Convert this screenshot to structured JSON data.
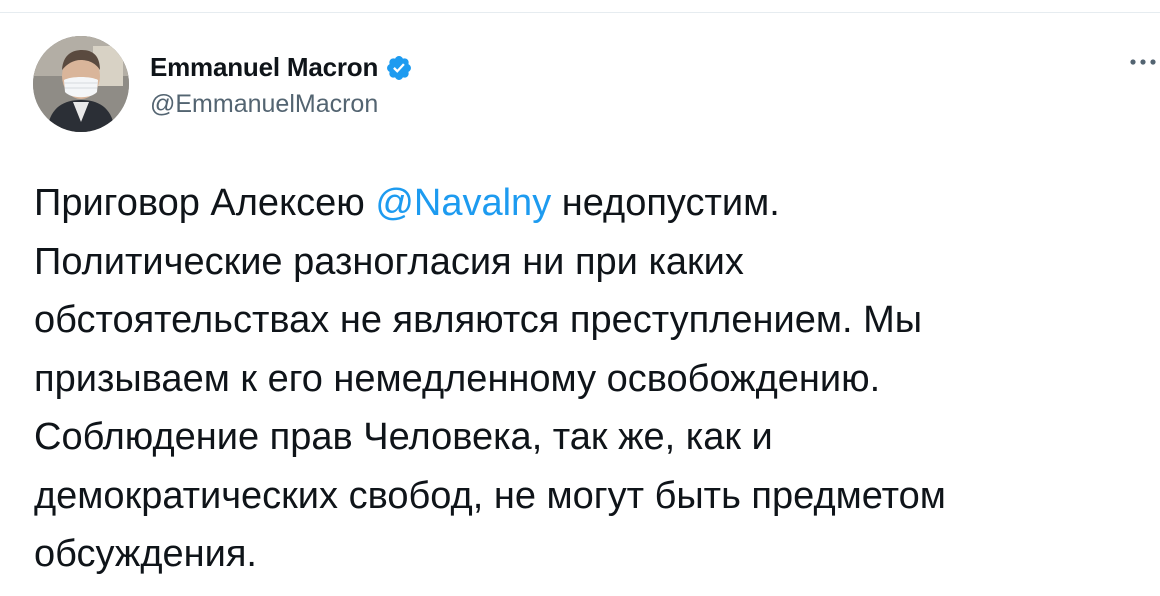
{
  "tweet": {
    "author": {
      "display_name": "Emmanuel Macron",
      "handle": "@EmmanuelMacron",
      "verified": true,
      "avatar_icon": "user-avatar-photo"
    },
    "text_before_mention": "Приговор Алексею ",
    "mention": "@Navalny",
    "text_after_mention": " недопустим.\nПолитические разногласия ни при каких\nобстоятельствах не являются преступлением. Мы\nпризываем к его немедленному освобождению.\nСоблюдение прав Человека, так же, как и\nдемократических свобод, не могут быть предметом\nобсуждения.",
    "more_icon": "more-horizontal-icon"
  },
  "colors": {
    "text": "#0f1419",
    "secondary": "#536471",
    "accent": "#1d9bf0"
  }
}
